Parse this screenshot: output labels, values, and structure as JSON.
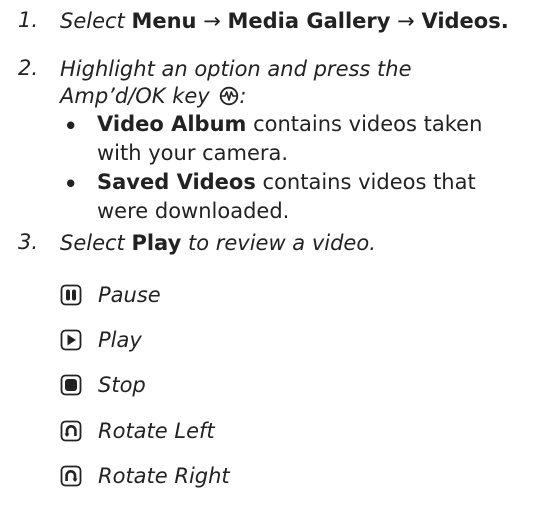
{
  "steps": [
    {
      "number": "1.",
      "prefix": "Select ",
      "path": [
        "Menu",
        "Media Gallery",
        "Videos"
      ],
      "arrow": "→",
      "suffix": "."
    },
    {
      "number": "2.",
      "line1": "Highlight an option and press the",
      "line2": "Amp’d/OK key",
      "line2_suffix": ":",
      "key_icon": "ampd-ok-key-icon",
      "bullets": [
        {
          "bold": "Video Album",
          "rest_line1": " contains videos taken",
          "line2": "with your camera."
        },
        {
          "bold": "Saved Videos",
          "rest_line1": " contains videos that",
          "line2": "were downloaded."
        }
      ]
    },
    {
      "number": "3.",
      "prefix": "Select ",
      "bold": "Play",
      "suffix": " to review a video."
    }
  ],
  "controls": [
    {
      "icon": "pause-icon",
      "label": "Pause"
    },
    {
      "icon": "play-icon",
      "label": "Play"
    },
    {
      "icon": "stop-icon",
      "label": "Stop"
    },
    {
      "icon": "rotate-left-icon",
      "label": "Rotate Left"
    },
    {
      "icon": "rotate-right-icon",
      "label": "Rotate Right"
    }
  ],
  "bullet_char": "•"
}
